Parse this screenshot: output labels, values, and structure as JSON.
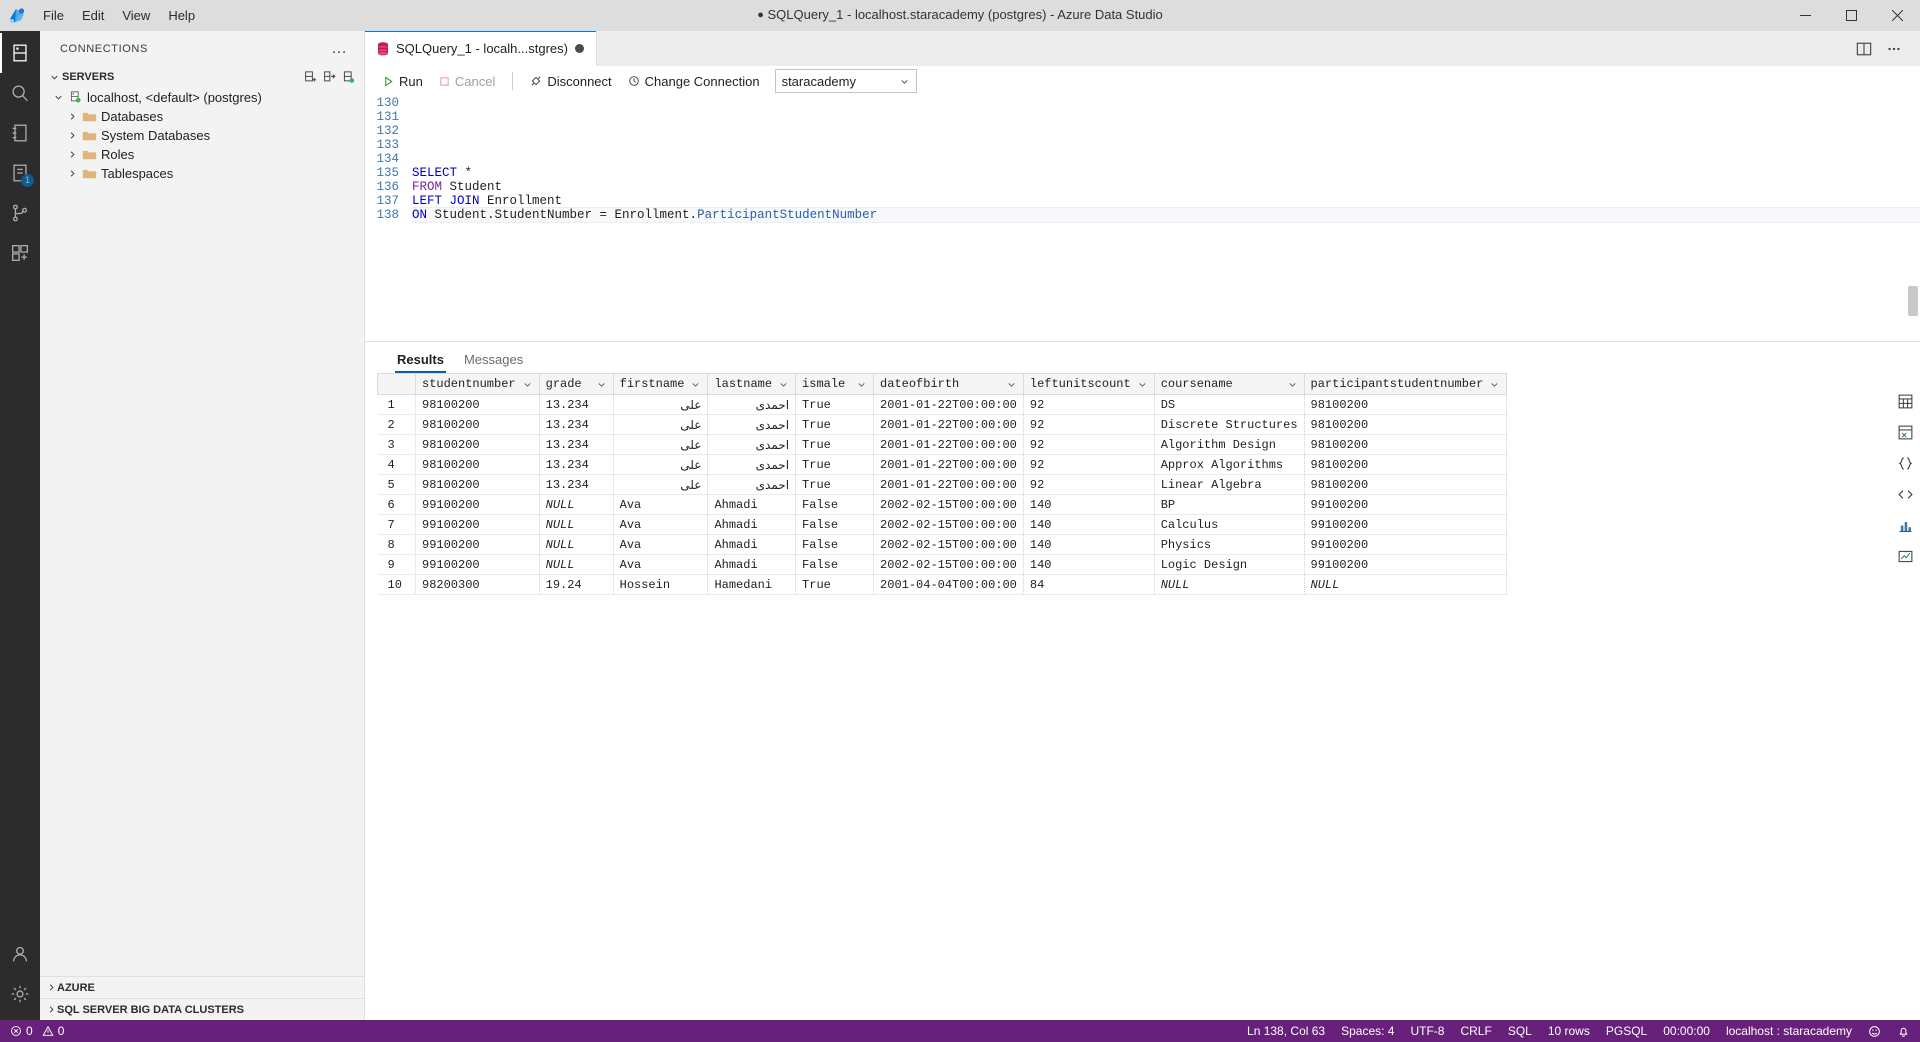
{
  "titlebar": {
    "app_icon": "azure-data-studio-logo",
    "menus": [
      "File",
      "Edit",
      "View",
      "Help"
    ],
    "title_dirty_marker": "●",
    "title": "SQLQuery_1 - localhost.staracademy (postgres) - Azure Data Studio",
    "window_controls": [
      "minimize",
      "maximize",
      "close"
    ]
  },
  "activitybar": {
    "items": [
      {
        "name": "connections-icon",
        "label": "Connections",
        "active": true,
        "badge": null
      },
      {
        "name": "search-icon",
        "label": "Search",
        "active": false,
        "badge": null
      },
      {
        "name": "notebooks-icon",
        "label": "Notebooks",
        "active": false,
        "badge": null
      },
      {
        "name": "source-control-icon",
        "label": "Source Control",
        "active": false,
        "badge": "1"
      },
      {
        "name": "git-branch-icon",
        "label": "Git",
        "active": false,
        "badge": null
      },
      {
        "name": "extensions-icon",
        "label": "Extensions",
        "active": false,
        "badge": null
      }
    ],
    "bottom_items": [
      {
        "name": "accounts-icon",
        "label": "Accounts"
      },
      {
        "name": "settings-gear-icon",
        "label": "Manage"
      }
    ]
  },
  "sidebar": {
    "header": "CONNECTIONS",
    "header_more": "…",
    "servers_section": {
      "label": "SERVERS",
      "expanded": true,
      "toolbar_icons": [
        "new-connection-icon",
        "new-connection-group-icon",
        "connect-server-icon"
      ]
    },
    "tree": [
      {
        "label": "localhost, <default> (postgres)",
        "icon": "server-connected-icon",
        "depth": 0,
        "expanded": true
      },
      {
        "label": "Databases",
        "icon": "folder-icon",
        "depth": 1,
        "expanded": false
      },
      {
        "label": "System Databases",
        "icon": "folder-icon",
        "depth": 1,
        "expanded": false
      },
      {
        "label": "Roles",
        "icon": "folder-icon",
        "depth": 1,
        "expanded": false
      },
      {
        "label": "Tablespaces",
        "icon": "folder-icon",
        "depth": 1,
        "expanded": false
      }
    ],
    "bottom_sections": [
      {
        "label": "AZURE",
        "expanded": false
      },
      {
        "label": "SQL SERVER BIG DATA CLUSTERS",
        "expanded": false
      }
    ]
  },
  "editor": {
    "tab": {
      "icon": "sql-file-icon",
      "label": "SQLQuery_1 - localh...stgres)",
      "dirty": true
    },
    "tabbar_actions": [
      "split-editor-icon",
      "more-actions-icon"
    ],
    "actionbar": {
      "run_label": "Run",
      "run_icon": "play-icon",
      "cancel_label": "Cancel",
      "cancel_icon": "stop-icon",
      "disconnect_label": "Disconnect",
      "disconnect_icon": "disconnect-icon",
      "change_connection_label": "Change Connection",
      "change_connection_icon": "change-connection-icon",
      "database_value": "staracademy"
    },
    "first_line_number": 130,
    "lines": [
      {
        "n": 130,
        "tokens": []
      },
      {
        "n": 131,
        "tokens": []
      },
      {
        "n": 132,
        "tokens": []
      },
      {
        "n": 133,
        "tokens": []
      },
      {
        "n": 134,
        "tokens": []
      },
      {
        "n": 135,
        "text": "SELECT *"
      },
      {
        "n": 136,
        "text": "FROM Student"
      },
      {
        "n": 137,
        "text": "LEFT JOIN Enrollment"
      },
      {
        "n": 138,
        "text": "ON Student.StudentNumber = Enrollment.ParticipantStudentNumber"
      }
    ]
  },
  "results": {
    "tabs": [
      {
        "label": "Results",
        "active": true
      },
      {
        "label": "Messages",
        "active": false
      }
    ],
    "columns": [
      "studentnumber",
      "grade",
      "firstname",
      "lastname",
      "ismale",
      "dateofbirth",
      "leftunitscount",
      "coursename",
      "participantstudentnumber"
    ],
    "rows": [
      {
        "n": "1",
        "studentnumber": "98100200",
        "grade": "13.234",
        "firstname": "علی",
        "lastname": "احمدی",
        "ismale": "True",
        "dateofbirth": "2001-01-22T00:00:00",
        "leftunitscount": "92",
        "coursename": "DS",
        "participantstudentnumber": "98100200"
      },
      {
        "n": "2",
        "studentnumber": "98100200",
        "grade": "13.234",
        "firstname": "علی",
        "lastname": "احمدی",
        "ismale": "True",
        "dateofbirth": "2001-01-22T00:00:00",
        "leftunitscount": "92",
        "coursename": "Discrete Structures",
        "participantstudentnumber": "98100200"
      },
      {
        "n": "3",
        "studentnumber": "98100200",
        "grade": "13.234",
        "firstname": "علی",
        "lastname": "احمدی",
        "ismale": "True",
        "dateofbirth": "2001-01-22T00:00:00",
        "leftunitscount": "92",
        "coursename": "Algorithm Design",
        "participantstudentnumber": "98100200"
      },
      {
        "n": "4",
        "studentnumber": "98100200",
        "grade": "13.234",
        "firstname": "علی",
        "lastname": "احمدی",
        "ismale": "True",
        "dateofbirth": "2001-01-22T00:00:00",
        "leftunitscount": "92",
        "coursename": "Approx Algorithms",
        "participantstudentnumber": "98100200"
      },
      {
        "n": "5",
        "studentnumber": "98100200",
        "grade": "13.234",
        "firstname": "علی",
        "lastname": "احمدی",
        "ismale": "True",
        "dateofbirth": "2001-01-22T00:00:00",
        "leftunitscount": "92",
        "coursename": "Linear Algebra",
        "participantstudentnumber": "98100200"
      },
      {
        "n": "6",
        "studentnumber": "99100200",
        "grade": "NULL",
        "firstname": "Ava",
        "lastname": "Ahmadi",
        "ismale": "False",
        "dateofbirth": "2002-02-15T00:00:00",
        "leftunitscount": "140",
        "coursename": "BP",
        "participantstudentnumber": "99100200"
      },
      {
        "n": "7",
        "studentnumber": "99100200",
        "grade": "NULL",
        "firstname": "Ava",
        "lastname": "Ahmadi",
        "ismale": "False",
        "dateofbirth": "2002-02-15T00:00:00",
        "leftunitscount": "140",
        "coursename": "Calculus",
        "participantstudentnumber": "99100200"
      },
      {
        "n": "8",
        "studentnumber": "99100200",
        "grade": "NULL",
        "firstname": "Ava",
        "lastname": "Ahmadi",
        "ismale": "False",
        "dateofbirth": "2002-02-15T00:00:00",
        "leftunitscount": "140",
        "coursename": "Physics",
        "participantstudentnumber": "99100200"
      },
      {
        "n": "9",
        "studentnumber": "99100200",
        "grade": "NULL",
        "firstname": "Ava",
        "lastname": "Ahmadi",
        "ismale": "False",
        "dateofbirth": "2002-02-15T00:00:00",
        "leftunitscount": "140",
        "coursename": "Logic Design",
        "participantstudentnumber": "99100200"
      },
      {
        "n": "10",
        "studentnumber": "98200300",
        "grade": "19.24",
        "firstname": "Hossein",
        "lastname": "Hamedani",
        "ismale": "True",
        "dateofbirth": "2001-04-04T00:00:00",
        "leftunitscount": "84",
        "coursename": "NULL",
        "participantstudentnumber": "NULL"
      }
    ],
    "rail_icons": [
      "save-as-csv-icon",
      "save-as-excel-icon",
      "save-as-json-icon",
      "save-as-xml-icon",
      "chart-icon",
      "visualizer-icon"
    ]
  },
  "statusbar": {
    "errors_icon": "error-icon",
    "errors": "0",
    "warnings_icon": "warning-icon",
    "warnings": "0",
    "cursor_position": "Ln 138, Col 63",
    "indentation": "Spaces: 4",
    "encoding": "UTF-8",
    "eol": "CRLF",
    "language": "SQL",
    "row_count": "10 rows",
    "provider": "PGSQL",
    "execution_time": "00:00:00",
    "connection": "localhost : staracademy",
    "notification_icon": "bell-icon",
    "feedback_icon": "smiley-icon"
  },
  "colors": {
    "accent": "#0078d4",
    "statusbar_bg": "#68217a",
    "activitybar_bg": "#2c2c2c",
    "sidebar_bg": "#f3f3f3",
    "keyword": "#0000c0",
    "keyword_alt": "#7a1fa2",
    "line_number": "#3b7aad"
  }
}
